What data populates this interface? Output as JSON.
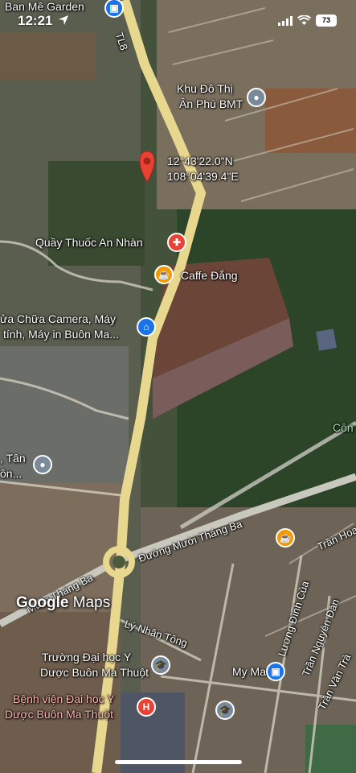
{
  "status_bar": {
    "time": "12:21",
    "battery": "73"
  },
  "coordinates": {
    "lat": "12°43'22.0\"N",
    "lng": "108°04'39.4\"E"
  },
  "places": {
    "ban_me_garden": "Ban Mê Garden",
    "khu_do_thi_line1": "Khu Đô Thị",
    "khu_do_thi_line2": "Ân Phú BMT",
    "quay_thuoc": "Quầy Thuốc An Nhàn",
    "caffe": "Caffe Đắng",
    "camera_line1": "ửa Chữa Camera, Máy",
    "camera_line2": "tính, Máy in Buôn Ma...",
    "tan_line1": ", Tân",
    "tan_line2": "ôn...",
    "con": "Côn",
    "truong_line1": "Trường Đại học Y",
    "truong_line2": "Dược Buôn Ma Thuột",
    "benh_vien_line1": "Bệnh viện Đại học Y",
    "benh_vien_line2": "Dược Buôn Ma Thuột",
    "my_mart": "My Mart"
  },
  "roads": {
    "tl8": "TL8",
    "muoi_thang_ba": "Đường Mười Tháng Ba",
    "muoi_thang_ba_left": "Mười Tháng Ba",
    "ly_nhan_tong": "Lý Nhân Tông",
    "luong_dinh_cua": "Lương Đình Của",
    "tran_nguyen_dan": "Trần Nguyên Đán",
    "tran_van_tra": "Trần Văn Trà",
    "tran_hoa": "Trần Hoa"
  },
  "branding": {
    "google": "Google",
    "maps": "Maps"
  },
  "colors": {
    "road": "#e8d78e",
    "pin_red": "#e94235",
    "shop_blue": "#1a73e8",
    "cafe_orange": "#f29900",
    "place_gray": "#7b8a99",
    "hospital_red": "#e94235"
  }
}
